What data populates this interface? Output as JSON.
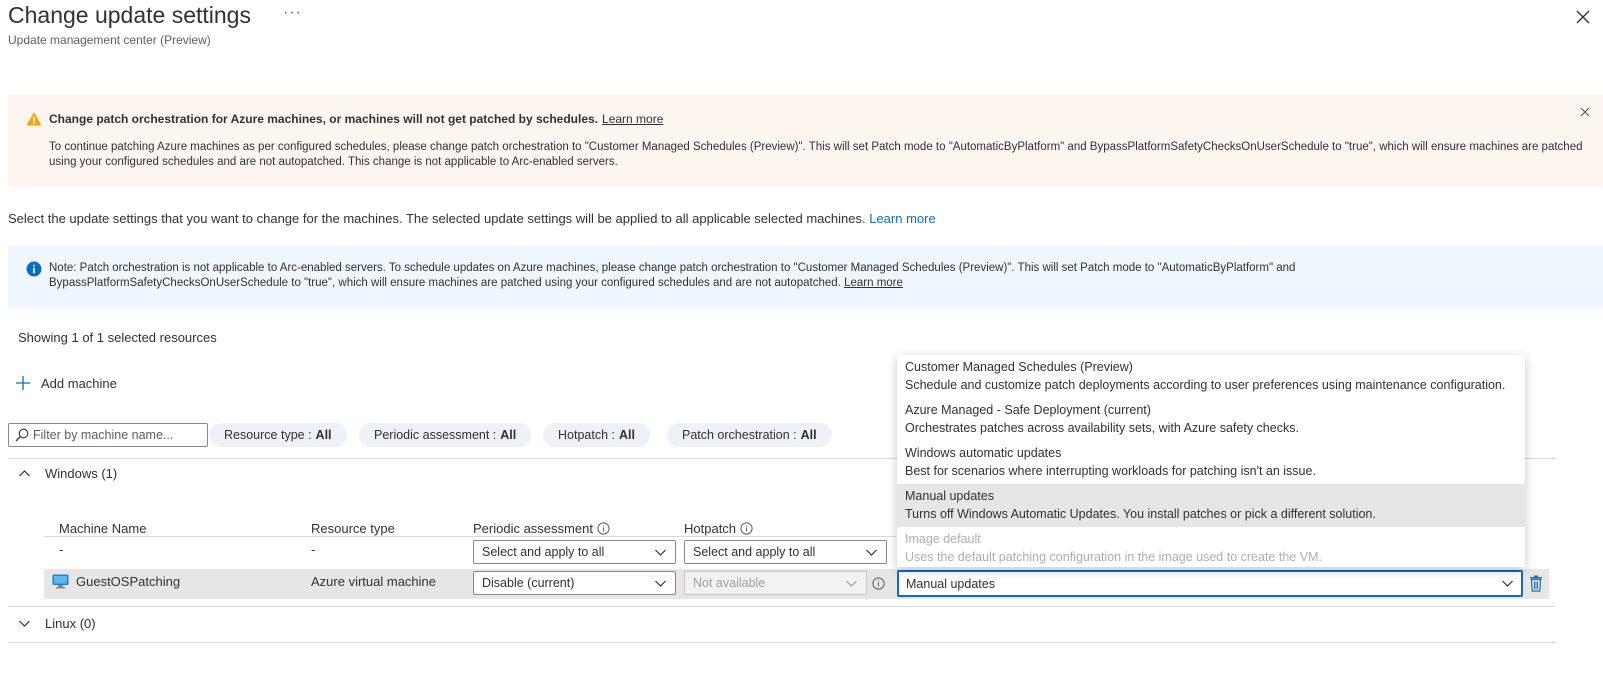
{
  "header": {
    "title": "Change update settings",
    "more_label": "···",
    "subtitle": "Update management center (Preview)"
  },
  "warning": {
    "title": "Change patch orchestration for Azure machines, or machines will not get patched by schedules.",
    "link": "Learn more",
    "body": "To continue patching Azure machines as per configured schedules, please change patch orchestration to \"Customer Managed Schedules (Preview)\". This will set Patch mode to \"AutomaticByPlatform\" and BypassPlatformSafetyChecksOnUserSchedule to \"true\", which will ensure machines are patched using your configured schedules and are not autopatched. This change is not applicable to Arc-enabled servers."
  },
  "intro": {
    "text": "Select the update settings that you want to change for the machines. The selected update settings will be applied to all applicable selected machines.",
    "link": "Learn more"
  },
  "note": {
    "text": "Note: Patch orchestration is not applicable to Arc-enabled servers. To schedule updates on Azure machines, please change patch orchestration to \"Customer Managed Schedules (Preview)\". This will set Patch mode to \"AutomaticByPlatform\" and BypassPlatformSafetyChecksOnUserSchedule to \"true\", which will ensure machines are patched using your configured schedules and are not autopatched.",
    "link": "Learn more"
  },
  "showing": "Showing 1 of 1 selected resources",
  "add_machine": "Add machine",
  "filters": {
    "search_placeholder": "Filter by machine name...",
    "pills": [
      {
        "label": "Resource type :",
        "value": "All"
      },
      {
        "label": "Periodic assessment :",
        "value": "All"
      },
      {
        "label": "Hotpatch :",
        "value": "All"
      },
      {
        "label": "Patch orchestration :",
        "value": "All"
      }
    ]
  },
  "groups": {
    "windows": "Windows (1)",
    "linux": "Linux (0)"
  },
  "table": {
    "columns": [
      "Machine Name",
      "Resource type",
      "Periodic assessment",
      "Hotpatch"
    ],
    "apply_row": {
      "name": "-",
      "type": "-",
      "assessment": "Select and apply to all",
      "hotpatch": "Select and apply to all"
    },
    "rows": [
      {
        "name": "GuestOSPatching",
        "type": "Azure virtual machine",
        "assessment": "Disable (current)",
        "hotpatch": "Not available",
        "orchestration": "Manual updates"
      }
    ]
  },
  "dropdown": {
    "options": [
      {
        "title": "Customer Managed Schedules (Preview)",
        "desc": "Schedule and customize patch deployments according to user preferences using maintenance configuration."
      },
      {
        "title": "Azure Managed - Safe Deployment (current)",
        "desc": "Orchestrates patches across availability sets, with Azure safety checks."
      },
      {
        "title": "Windows automatic updates",
        "desc": "Best for scenarios where interrupting workloads for patching isn't an issue."
      },
      {
        "title": "Manual updates",
        "desc": "Turns off Windows Automatic Updates. You install patches or pick a different solution."
      },
      {
        "title": "Image default",
        "desc": "Uses the default patching configuration in the image used to create the VM."
      }
    ]
  },
  "colors": {
    "accent": "#0f6cbd",
    "warning_bg": "#fdf6f0",
    "warning_icon": "#f7a30c",
    "info_bg": "#f0f6fd",
    "delete_icon": "#0f6cbd"
  }
}
